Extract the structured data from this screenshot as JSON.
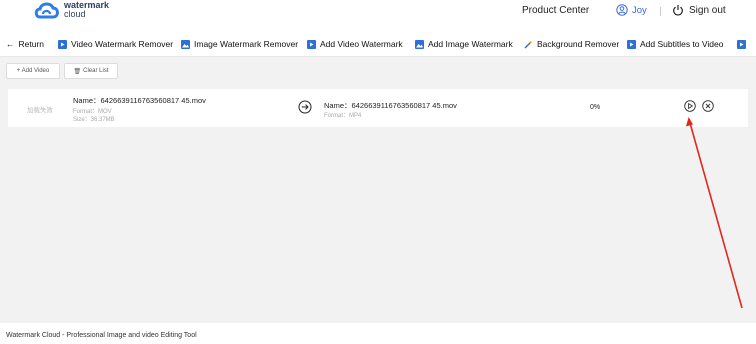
{
  "header": {
    "logo_line1": "watermark",
    "logo_line2": "cloud",
    "product_center": "Product Center",
    "user_name": "Joy",
    "sign_out": "Sign out"
  },
  "nav": {
    "return": "Return",
    "items": [
      "Video Watermark Remover",
      "Image Watermark Remover",
      "Add Video Watermark",
      "Add Image Watermark",
      "Background Remover",
      "Add Subtitles to Video"
    ]
  },
  "toolbar": {
    "add_video": "+ Add Video",
    "clear_list": "Clear List"
  },
  "task": {
    "thumb_text": "加载失败",
    "source_name": "Name：6426639116763560817 45.mov",
    "source_format": "Format：MOV",
    "source_size": "Size：36.37MB",
    "target_name": "Name：6426639116763560817 45.mov",
    "target_format": "Format：MP4",
    "progress": "0%"
  },
  "footer": {
    "text": "Watermark Cloud - Professional Image and video Editing Tool"
  },
  "colors": {
    "accent": "#3b6be0",
    "arrow": "#e0281e",
    "content_bg": "#f2f2f2"
  }
}
